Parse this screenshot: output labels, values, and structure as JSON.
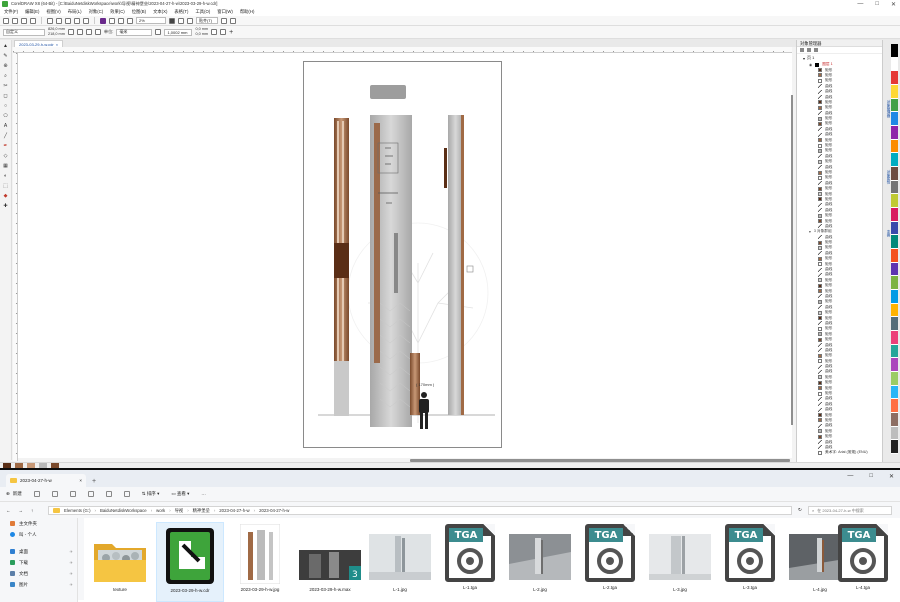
{
  "cdr": {
    "title": "CorelDRAW X8 (64-Bit) - [C:\\BaiduNetdiskWorkspace\\work\\导视\\精神堡垒\\2023-04-27-h-w\\2023-03-29-h-w.cdr]",
    "window_buttons": [
      "—",
      "□",
      "✕"
    ],
    "menu": [
      "文件(F)",
      "编辑(E)",
      "视图(V)",
      "布局(L)",
      "对象(C)",
      "效果(C)",
      "位图(B)",
      "文本(X)",
      "表格(T)",
      "工具(O)",
      "窗口(W)",
      "帮助(H)"
    ],
    "zoom": "2%",
    "snap_label": "贴齐(T)",
    "toolbar2": {
      "preset": "自定义",
      "width": "826,0 mm",
      "height": "218,0 mm",
      "units_label": "单位:",
      "units": "毫米",
      "nudge": "1,0002 mm",
      "dup_x": "0,0 mm",
      "dup_y": "0,0 mm"
    },
    "doc_tab": "2023-03-29-h-w.cdr",
    "tools": [
      "▲",
      "✎",
      "⊕",
      "⌕",
      "✂",
      "◻",
      "○",
      "⬠",
      "A",
      "╱",
      "✒",
      "◇",
      "▦",
      "◐",
      "⬚",
      "◆",
      "✚"
    ],
    "design_caption": "( 170mm )",
    "docker": {
      "title": "对象管理器",
      "page": "页 1",
      "layer1": "图层 1",
      "group": "3 对象群组",
      "shape_label": "矩形",
      "curve_label": "曲线",
      "bottom_text": "美术字: Arial (常规) (ENU)"
    },
    "side_tabs": [
      "对象管理器",
      "对象属性",
      "变换"
    ],
    "palette": [
      "#000000",
      "#ffffff",
      "#e53935",
      "#fdd835",
      "#43a047",
      "#1e88e5",
      "#8e24aa",
      "#fb8c00",
      "#00acc1",
      "#6d4c41",
      "#757575",
      "#c0ca33",
      "#d81b60",
      "#3949ab",
      "#00897b",
      "#f4511e",
      "#5e35b1",
      "#7cb342",
      "#039be5",
      "#ffb300",
      "#546e7a",
      "#ec407a",
      "#26a69a",
      "#ab47bc",
      "#9ccc65",
      "#29b6f6",
      "#ff7043",
      "#8d6e63",
      "#bdbdbd",
      "#212121"
    ],
    "colors": {
      "bronze": "#a06a45",
      "bronze_dark": "#5a2e16",
      "panel_grey": "#b9b9b9",
      "panel_light": "#d2d2d2"
    }
  },
  "explorer": {
    "tab_title": "2023-04-27-h-w",
    "new_label": "新建",
    "sort_label": "排序",
    "view_label": "查看",
    "more_label": "···",
    "path": [
      "Elements (G:)",
      "BaiduNetdiskWorkspace",
      "work",
      "导视",
      "精神堡垒",
      "2023-04-27-h-w",
      "2023-04-27-h-w"
    ],
    "search_placeholder": "在 2023-04-27-h-w 中搜索",
    "nav": [
      "主文件夹",
      "叫 - 个人",
      "桌面",
      "下载",
      "文档",
      "图片"
    ],
    "files": [
      {
        "name": "texture",
        "kind": "folder"
      },
      {
        "name": "2023-03-29-h-w.cdr",
        "kind": "cdr"
      },
      {
        "name": "2023-03-29-h-w.jpg",
        "kind": "jpg"
      },
      {
        "name": "2023-03-29-h-w.max",
        "kind": "max"
      },
      {
        "name": "L-1.jpg",
        "kind": "photo"
      },
      {
        "name": "L-1.tga",
        "kind": "tga"
      },
      {
        "name": "L-2.jpg",
        "kind": "photo"
      },
      {
        "name": "L-2.tga",
        "kind": "tga"
      },
      {
        "name": "L-3.jpg",
        "kind": "photo"
      },
      {
        "name": "L-3.tga",
        "kind": "tga"
      },
      {
        "name": "L-4.jpg",
        "kind": "photo"
      },
      {
        "name": "L-4.tga",
        "kind": "tga"
      }
    ],
    "tga_label": "TGA",
    "max_badge": "3"
  }
}
